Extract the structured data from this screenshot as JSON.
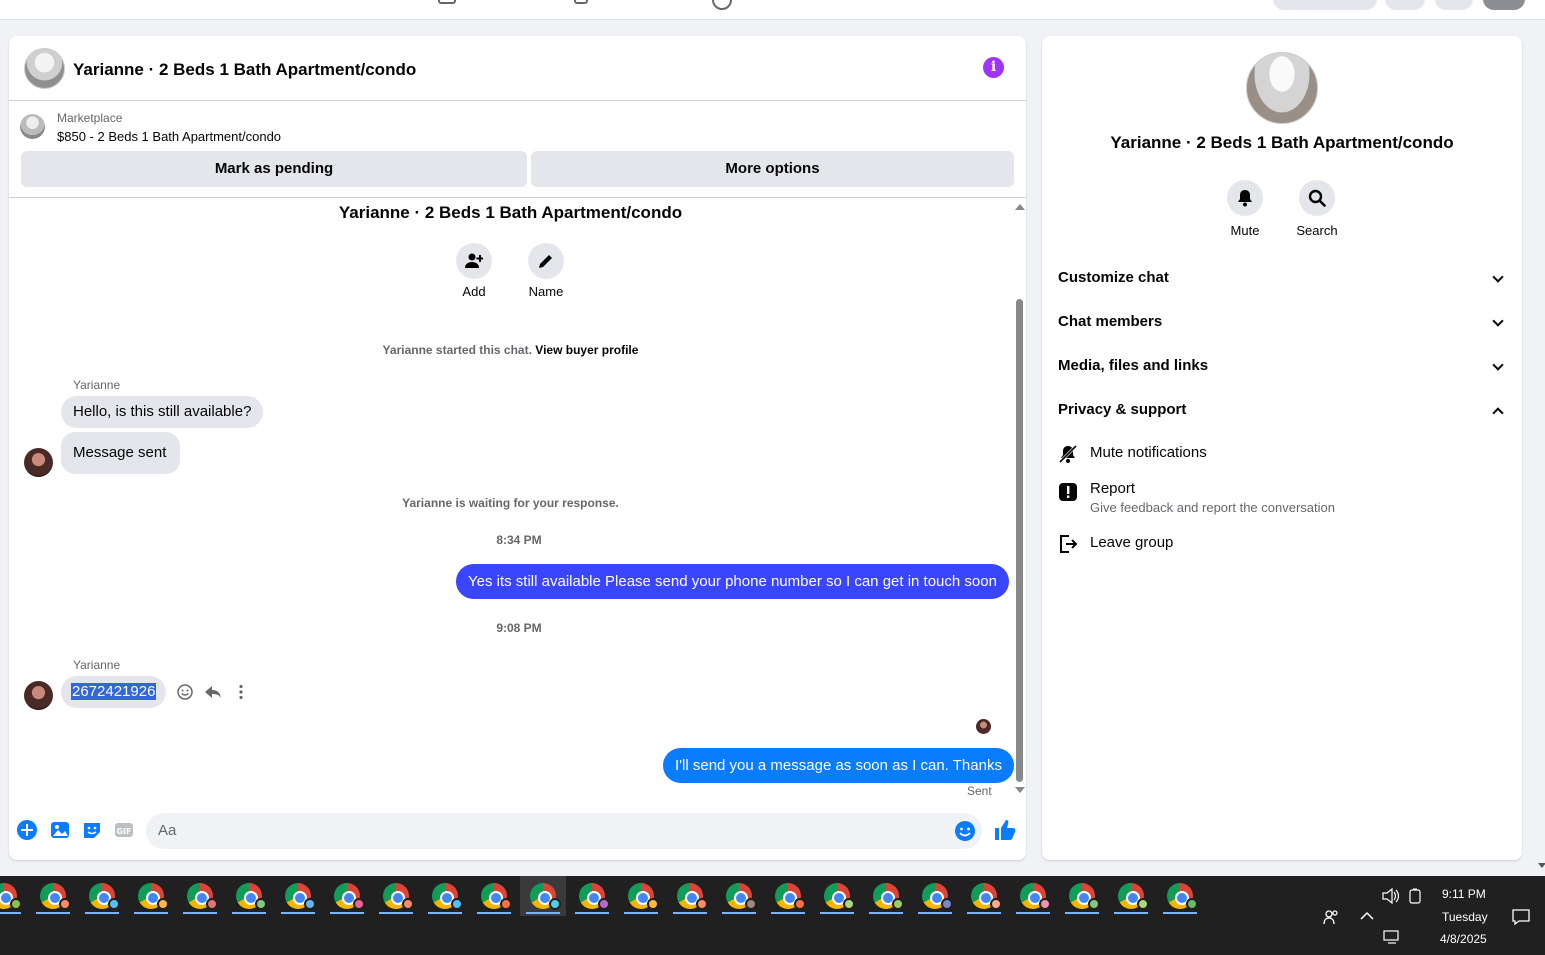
{
  "chat": {
    "title": "Yarianne · 2 Beds 1 Bath Apartment/condo",
    "marketplace_label": "Marketplace",
    "listing": "$850 - 2 Beds 1 Bath Apartment/condo",
    "mark_pending": "Mark as pending",
    "more_options": "More options",
    "conversation_title": "Yarianne · 2 Beds 1 Bath Apartment/condo",
    "add_label": "Add",
    "name_label": "Name",
    "started_text": "Yarianne started this chat.",
    "view_buyer_profile": "View buyer profile",
    "messages": {
      "sender1": "Yarianne",
      "msg1": "Hello, is this still available?",
      "msg2": "Message sent",
      "waiting": "Yarianne is waiting for your response.",
      "time1": "8:34 PM",
      "msg3": "Yes its still available Please send your phone number so I can get in touch soon",
      "time2": "9:08 PM",
      "sender2": "Yarianne",
      "msg4": "2672421926",
      "msg5": "I'll send you a message as soon as I can. Thanks",
      "status": "Sent"
    },
    "composer_placeholder": "Aa"
  },
  "details": {
    "title": "Yarianne · 2 Beds 1 Bath Apartment/condo",
    "mute_label": "Mute",
    "search_label": "Search",
    "sections": {
      "customize": "Customize chat",
      "members": "Chat members",
      "media": "Media, files and links",
      "privacy": "Privacy & support"
    },
    "options": {
      "mute_notifications": "Mute notifications",
      "report": "Report",
      "report_desc": "Give feedback and report the conversation",
      "leave": "Leave group"
    }
  },
  "taskbar": {
    "time": "9:11 PM",
    "day": "Tuesday",
    "date": "4/8/2025",
    "app_count": 25
  },
  "colors": {
    "accent": "#0a7cff",
    "info": "#a033ff",
    "taskbar": "#202020"
  }
}
